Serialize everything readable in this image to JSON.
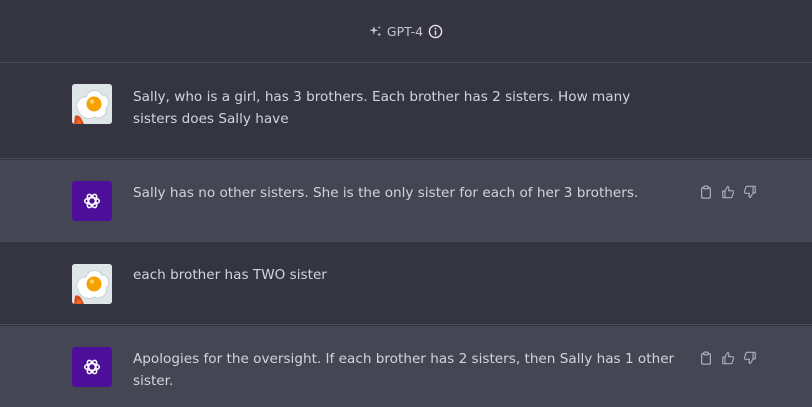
{
  "header": {
    "model_label": "GPT-4",
    "model_icon": "sparkle-icon",
    "info_icon": "info-icon"
  },
  "messages": [
    {
      "role": "user",
      "text": "Sally, who is a girl, has 3 brothers. Each brother has 2 sisters. How many sisters does Sally have"
    },
    {
      "role": "assistant",
      "text": "Sally has no other sisters. She is the only sister for each of her 3 brothers."
    },
    {
      "role": "user",
      "text": "each brother has TWO sister"
    },
    {
      "role": "assistant",
      "text": "Apologies for the oversight. If each brother has 2 sisters, then Sally has 1 other sister."
    }
  ],
  "actions": [
    "copy-icon",
    "thumbs-up-icon",
    "thumbs-down-icon"
  ],
  "colors": {
    "background": "#343541",
    "assistant_background": "#444654",
    "gpt_avatar": "#4d0f9a",
    "text": "#d1d5db"
  }
}
